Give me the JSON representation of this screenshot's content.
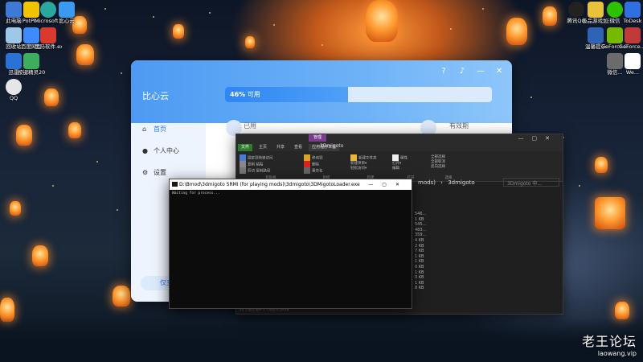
{
  "desktop": {
    "left_icons": [
      {
        "label": "此电脑",
        "icon": "computer-icon",
        "color": "#3d7ad6"
      },
      {
        "label": "PotPl...",
        "icon": "potplayer-icon",
        "color": "#f2c400"
      },
      {
        "label": "Microsoft Edge",
        "icon": "edge-icon",
        "color": "#2aa8a0"
      },
      {
        "label": "比心云",
        "icon": "cloud-icon",
        "color": "#3a9af0"
      },
      {
        "label": "回收站",
        "icon": "recycle-bin-icon",
        "color": "#9fc7e8"
      },
      {
        "label": "百度网盘",
        "icon": "baidu-netdisk-icon",
        "color": "#3d8bff"
      },
      {
        "label": "黑马软件.ex...",
        "icon": "app-icon",
        "color": "#d83b2e"
      },
      {
        "label": "迅雷",
        "icon": "xunlei-icon",
        "color": "#2a72d4"
      },
      {
        "label": "按键精灵2014",
        "icon": "keysprite-icon",
        "color": "#3cae5d"
      },
      {
        "label": "QQ",
        "icon": "qq-icon",
        "color": "#e6e6e6"
      }
    ],
    "right_icons": [
      {
        "label": "腾讯QQ",
        "icon": "qq-icon",
        "color": "#222222"
      },
      {
        "label": "极品游戏加速",
        "icon": "game-icon",
        "color": "#e8c23a"
      },
      {
        "label": "微信",
        "icon": "wechat-icon",
        "color": "#2dc100"
      },
      {
        "label": "ToDesk",
        "icon": "todesk-icon",
        "color": "#2f6fe0"
      },
      {
        "label": "温馨提示",
        "icon": "shield-icon",
        "color": "#2e63b8"
      },
      {
        "label": "GeForce Exper...",
        "icon": "nvidia-icon",
        "color": "#76b900"
      },
      {
        "label": "GeForce... 4K",
        "icon": "app-icon",
        "color": "#c03a3a"
      },
      {
        "label": "微信...",
        "icon": "app-icon",
        "color": "#6b6b6b"
      },
      {
        "label": "We...",
        "icon": "app-icon",
        "color": "#ffffff"
      }
    ]
  },
  "cloud_app": {
    "brand": "比心云",
    "progress_percent": 46,
    "progress_text_value": "46%",
    "progress_text_suffix": "可用",
    "menu": [
      {
        "label": "首页",
        "icon": "home-icon",
        "active": true
      },
      {
        "label": "个人中心",
        "icon": "user-icon",
        "active": false
      },
      {
        "label": "设置",
        "icon": "gear-icon",
        "active": false
      }
    ],
    "stats": {
      "used": "已用",
      "expiry": "有效期"
    },
    "bottom_button": "仅支"
  },
  "explorer": {
    "context_tab": "管理",
    "title": "3Dmigoto",
    "ribbon_tabs": [
      "文件",
      "主页",
      "共享",
      "查看",
      "应用程序工具"
    ],
    "groups": [
      {
        "label": "剪贴板",
        "items": [
          "固定到快速访问",
          "复制",
          "粘贴",
          "剪切",
          "复制路径",
          "粘贴快捷方式"
        ]
      },
      {
        "label": "组织",
        "items": [
          "移动到",
          "复制到",
          "删除",
          "重命名"
        ]
      },
      {
        "label": "新建",
        "items": [
          "新建文件夹",
          "新建项目▾",
          "轻松访问▾"
        ]
      },
      {
        "label": "打开",
        "items": [
          "属性",
          "打开▾",
          "编辑",
          "历史记录"
        ]
      },
      {
        "label": "选择",
        "items": [
          "全部选择",
          "全部取消",
          "反向选择"
        ]
      }
    ],
    "address_tail": "mods)",
    "address_sep": "›",
    "address_current": "3dmigoto",
    "search_placeholder": "3Dmigoto 中...",
    "sizes": [
      "546...",
      "1 KB",
      "545...",
      "483...",
      "359...",
      "4 KB",
      "2 KB",
      "7 KB",
      "1 KB",
      "1 KB",
      "0 KB",
      "1 KB",
      "0 KB",
      "1 KB",
      "8 KB"
    ],
    "status_text": "23 个项目  选中 1 个项目  6.59 KB"
  },
  "console": {
    "title": "D:\\Bmod\\3dmigoto SRMI (for playing mods)\\3dmigoto\\3DMigotoLoader.exe",
    "output": "Waiting for process..."
  },
  "watermark": {
    "line1": "老王论坛",
    "line2": "laowang.vip"
  }
}
